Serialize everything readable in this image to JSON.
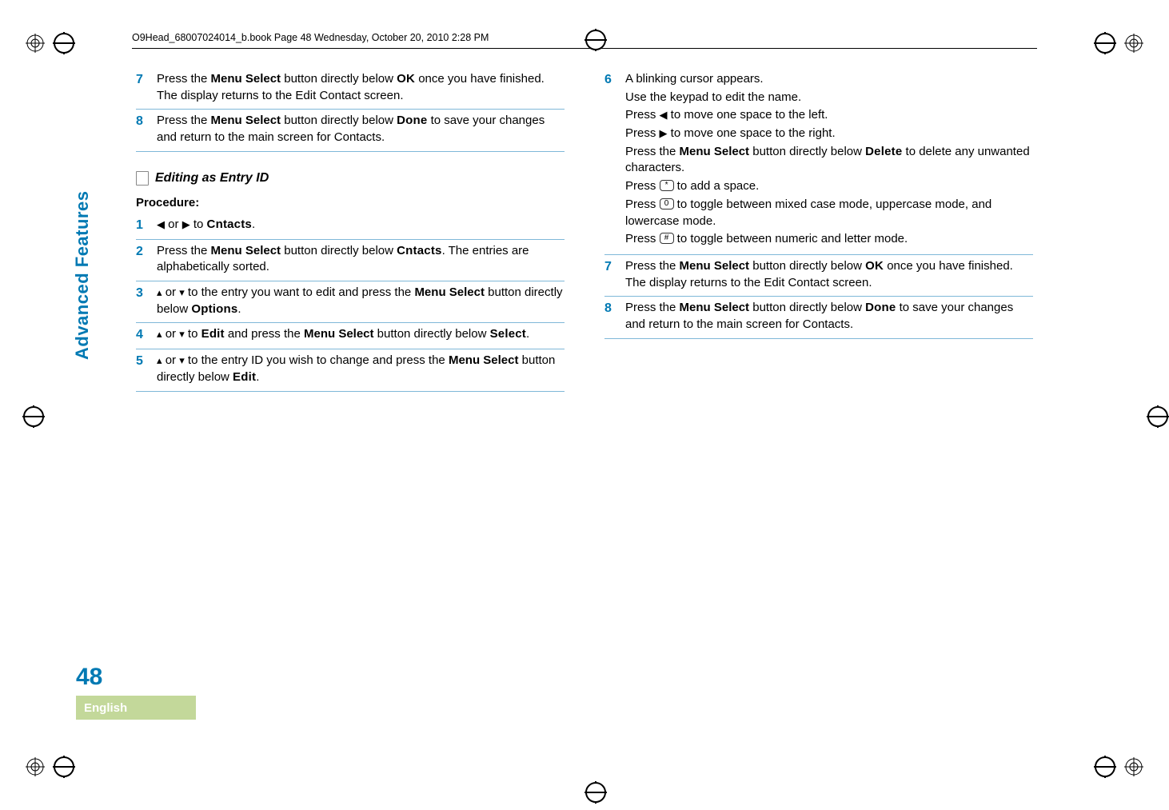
{
  "header": "O9Head_68007024014_b.book  Page 48  Wednesday, October 20, 2010  2:28 PM",
  "side_tab": "Advanced Features",
  "page_number": "48",
  "language": "English",
  "left": {
    "step7": {
      "t1": "Press the ",
      "b1": "Menu Select",
      "t2": " button directly below ",
      "m1": "OK",
      "t3": " once you have finished. The display returns to the Edit Contact screen."
    },
    "step8": {
      "t1": "Press the ",
      "b1": "Menu Select",
      "t2": " button directly below ",
      "m1": "Done",
      "t3": " to save your changes and return to the main screen for Contacts."
    },
    "section_title": "Editing as Entry ID",
    "procedure": "Procedure:",
    "step1": {
      "t1": " or ",
      "t2": " to ",
      "m1": "Cntacts",
      "t3": "."
    },
    "step2": {
      "t1": "Press the ",
      "b1": "Menu Select",
      "t2": " button directly below ",
      "m1": "Cntacts",
      "t3": ". The entries are alphabetically sorted."
    },
    "step3": {
      "t1": " or ",
      "t2": " to the entry you want to edit and press the ",
      "b1": "Menu Select",
      "t3": " button directly below ",
      "m1": "Options",
      "t4": "."
    },
    "step4": {
      "t1": " or ",
      "t2": " to ",
      "m1": "Edit",
      "t3": " and press the ",
      "b1": "Menu Select",
      "t4": " button directly below ",
      "m2": "Select",
      "t5": "."
    },
    "step5": {
      "t1": " or ",
      "t2": " to the entry ID you wish to change and press the ",
      "b1": "Menu Select",
      "t3": " button directly below ",
      "m1": "Edit",
      "t4": "."
    }
  },
  "right": {
    "step6": {
      "l1": "A blinking cursor appears.",
      "l2": "Use the keypad to edit the name.",
      "l3a": "Press ",
      "l3b": " to move one space to the left.",
      "l4a": "Press ",
      "l4b": " to move one space to the right.",
      "l5a": "Press the ",
      "l5b": "Menu Select",
      "l5c": " button directly below ",
      "l5d": "Delete",
      "l5e": " to delete any unwanted characters.",
      "l6a": "Press ",
      "k1": "*",
      "l6b": " to add a space.",
      "l7a": "Press ",
      "k2": "0",
      "l7b": " to toggle between mixed case mode, uppercase mode, and lowercase mode.",
      "l8a": "Press ",
      "k3": "#",
      "l8b": " to toggle between numeric and letter mode."
    },
    "step7": {
      "t1": "Press the ",
      "b1": "Menu Select",
      "t2": " button directly below ",
      "m1": "OK",
      "t3": " once you have finished. The display returns to the Edit Contact screen."
    },
    "step8": {
      "t1": "Press the ",
      "b1": "Menu Select",
      "t2": " button directly below ",
      "m1": "Done",
      "t3": " to save your changes and return to the main screen for Contacts."
    }
  },
  "nums": {
    "n1": "1",
    "n2": "2",
    "n3": "3",
    "n4": "4",
    "n5": "5",
    "n6": "6",
    "n7": "7",
    "n8": "8"
  }
}
